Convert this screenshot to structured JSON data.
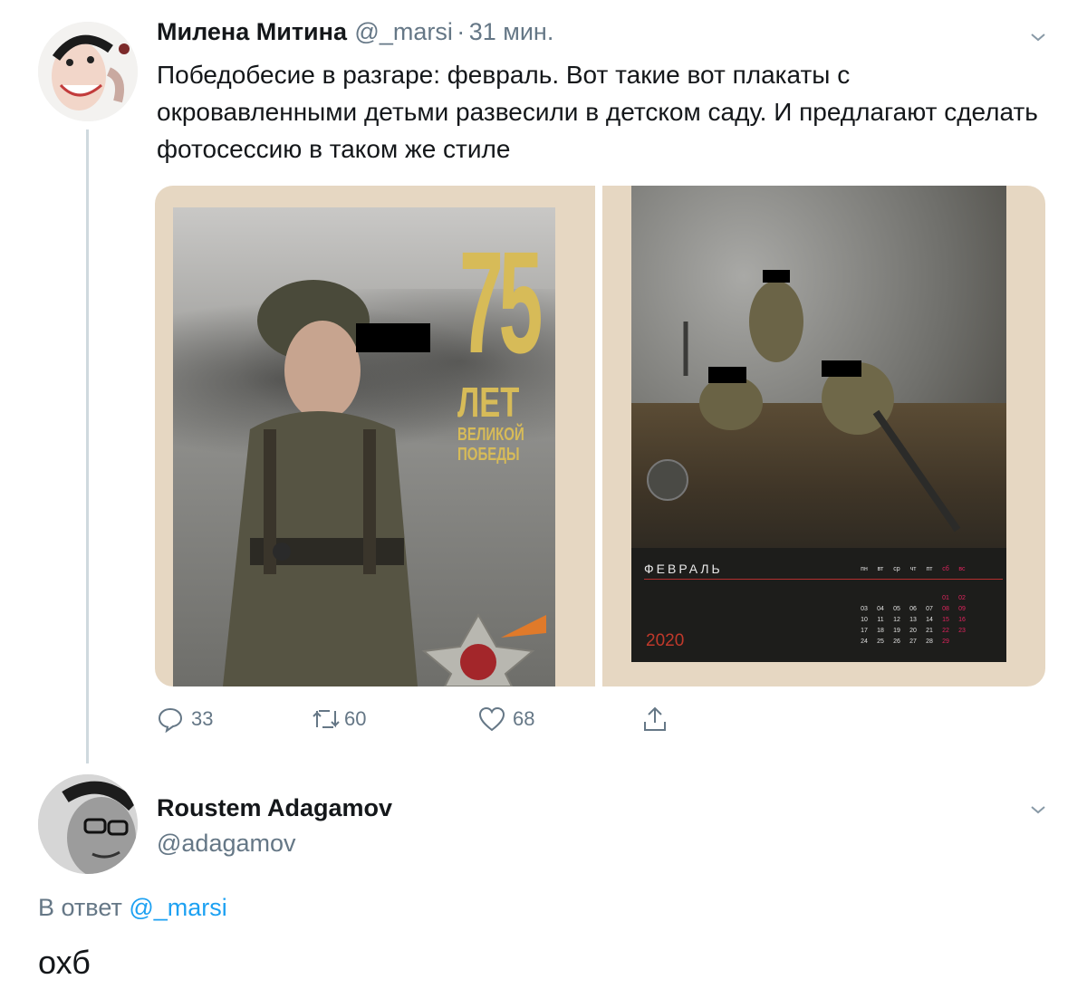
{
  "tweet1": {
    "author_name": "Милена Митина",
    "author_handle": "@_marsi",
    "separator": "·",
    "time": "31 мин.",
    "text": "Победобесие в разгаре: февраль. Вот такие вот плакаты с окровавленными детьми развесили в детском саду. И предлагают сделать фотосессию в таком же стиле",
    "media": {
      "left_poster": {
        "big_number": "75",
        "line1": "ЛЕТ",
        "line2": "ВЕЛИКОЙ",
        "line3": "ПОБЕДЫ"
      },
      "right_poster": {
        "month": "ФЕВРАЛЬ",
        "year": "2020",
        "weekdays": [
          "пн",
          "вт",
          "ср",
          "чт",
          "пт",
          "сб",
          "вс"
        ],
        "weeks": [
          [
            "",
            "",
            "",
            "",
            "",
            "01",
            "02"
          ],
          [
            "03",
            "04",
            "05",
            "06",
            "07",
            "08",
            "09"
          ],
          [
            "10",
            "11",
            "12",
            "13",
            "14",
            "15",
            "16"
          ],
          [
            "17",
            "18",
            "19",
            "20",
            "21",
            "22",
            "23"
          ],
          [
            "24",
            "25",
            "26",
            "27",
            "28",
            "29",
            ""
          ]
        ]
      }
    },
    "actions": {
      "replies": "33",
      "retweets": "60",
      "likes": "68"
    },
    "icons": [
      "reply-icon",
      "retweet-icon",
      "like-icon",
      "share-icon",
      "chevron-down-icon"
    ]
  },
  "tweet2": {
    "author_name": "Roustem Adagamov",
    "author_handle": "@adagamov",
    "reply_prefix": "В ответ",
    "reply_to": "@_marsi",
    "text": "охб"
  },
  "colors": {
    "text": "#14171a",
    "secondary": "#657786",
    "link": "#1da1f2",
    "thread": "#cfd9de",
    "red": "#e0245e"
  }
}
